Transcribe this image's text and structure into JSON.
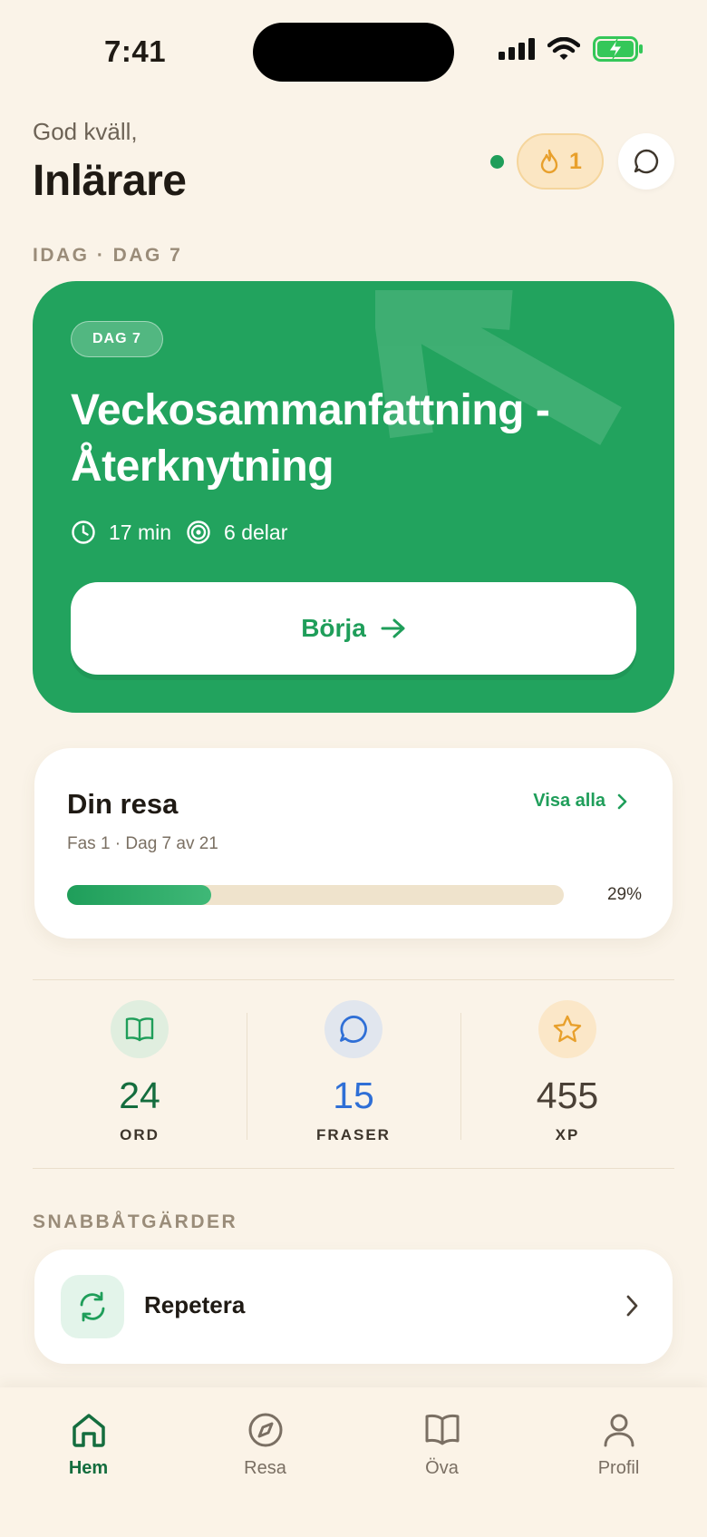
{
  "status_bar": {
    "time": "7:41"
  },
  "header": {
    "greeting": "God kväll,",
    "name": "Inlärare",
    "streak_count": "1"
  },
  "today": {
    "section_label": "IDAG · DAG 7",
    "day_pill": "DAG 7",
    "title": "Veckosammanfattning - Återknytning",
    "duration": "17 min",
    "parts": "6 delar",
    "start_label": "Börja"
  },
  "journey": {
    "title": "Din resa",
    "see_all": "Visa alla",
    "subtitle": "Fas 1 · Dag 7 av 21",
    "progress": 0.29,
    "progress_label": "29%"
  },
  "stats": [
    {
      "value": "24",
      "label": "ORD",
      "color": "#146d3e",
      "icon": "book-icon"
    },
    {
      "value": "15",
      "label": "FRASER",
      "color": "#2f6fd6",
      "icon": "chat-bubble-icon"
    },
    {
      "value": "455",
      "label": "XP",
      "color": "#4a4036",
      "icon": "star-icon"
    }
  ],
  "quick_actions": {
    "section_label": "SNABBÅTGÄRDER",
    "items": [
      {
        "label": "Repetera",
        "icon": "refresh-icon"
      }
    ]
  },
  "tabs": [
    {
      "label": "Hem",
      "icon": "home-icon",
      "active": true
    },
    {
      "label": "Resa",
      "icon": "compass-icon",
      "active": false
    },
    {
      "label": "Öva",
      "icon": "open-book-icon",
      "active": false
    },
    {
      "label": "Profil",
      "icon": "person-icon",
      "active": false
    }
  ],
  "colors": {
    "background": "#faf3e8",
    "brand_green": "#22a35e",
    "accent_orange": "#e8a02c"
  }
}
